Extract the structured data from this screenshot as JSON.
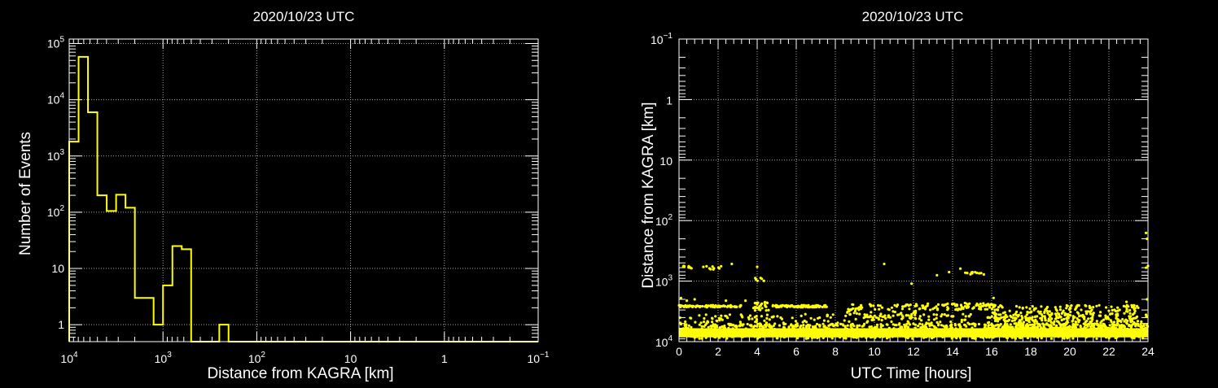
{
  "colors": {
    "background": "#000000",
    "axis": "#ffffff",
    "grid": "#aaaaaa",
    "series": "#ffff00"
  },
  "chart_data": [
    {
      "type": "histogram",
      "title": "2020/10/23 UTC",
      "xlabel": "Distance from KAGRA [km]",
      "ylabel": "Number of Events",
      "x_scale": "log",
      "x_reversed": true,
      "x_range": [
        10000,
        0.1
      ],
      "y_scale": "log",
      "y_range": [
        0.5,
        120000
      ],
      "grid": true,
      "x_tick_labels": [
        {
          "v": 10000,
          "base": "10",
          "exp": "4"
        },
        {
          "v": 1000,
          "base": "10",
          "exp": "3"
        },
        {
          "v": 100,
          "base": "10",
          "exp": "2"
        },
        {
          "v": 10,
          "base": "10",
          "exp": ""
        },
        {
          "v": 1,
          "base": "1",
          "exp": ""
        },
        {
          "v": 0.1,
          "base": "10",
          "exp": "−1"
        }
      ],
      "y_tick_labels": [
        {
          "v": 1,
          "base": "1",
          "exp": ""
        },
        {
          "v": 10,
          "base": "10",
          "exp": ""
        },
        {
          "v": 100,
          "base": "10",
          "exp": "2"
        },
        {
          "v": 1000,
          "base": "10",
          "exp": "3"
        },
        {
          "v": 10000,
          "base": "10",
          "exp": "4"
        },
        {
          "v": 100000,
          "base": "10",
          "exp": "5"
        }
      ],
      "bins": [
        {
          "from": 10000,
          "to": 7943,
          "value": 1800
        },
        {
          "from": 7943,
          "to": 6310,
          "value": 58000
        },
        {
          "from": 6310,
          "to": 5012,
          "value": 6000
        },
        {
          "from": 5012,
          "to": 3981,
          "value": 200
        },
        {
          "from": 3981,
          "to": 3162,
          "value": 105
        },
        {
          "from": 3162,
          "to": 2512,
          "value": 205
        },
        {
          "from": 2512,
          "to": 1995,
          "value": 120
        },
        {
          "from": 1995,
          "to": 1585,
          "value": 3
        },
        {
          "from": 1585,
          "to": 1259,
          "value": 3
        },
        {
          "from": 1259,
          "to": 1000,
          "value": 1
        },
        {
          "from": 1000,
          "to": 794,
          "value": 5
        },
        {
          "from": 794,
          "to": 631,
          "value": 25
        },
        {
          "from": 631,
          "to": 501,
          "value": 22
        },
        {
          "from": 501,
          "to": 398,
          "value": 0
        },
        {
          "from": 398,
          "to": 316,
          "value": 0
        },
        {
          "from": 316,
          "to": 251,
          "value": 0
        },
        {
          "from": 251,
          "to": 200,
          "value": 1
        },
        {
          "from": 200,
          "to": 158,
          "value": 0
        }
      ]
    },
    {
      "type": "scatter",
      "title": "2020/10/23 UTC",
      "xlabel": "UTC Time [hours]",
      "ylabel": "Distance from KAGRA [km]",
      "x_range": [
        0,
        24
      ],
      "y_scale": "log",
      "y_reversed": true,
      "y_range": [
        0.1,
        10000
      ],
      "grid": true,
      "x_ticks": [
        "0",
        "2",
        "4",
        "6",
        "8",
        "10",
        "12",
        "14",
        "16",
        "18",
        "20",
        "22",
        "24"
      ],
      "y_tick_labels": [
        {
          "v": 0.1,
          "base": "10",
          "exp": "−1"
        },
        {
          "v": 1,
          "base": "1",
          "exp": ""
        },
        {
          "v": 10,
          "base": "10",
          "exp": ""
        },
        {
          "v": 100,
          "base": "10",
          "exp": "2"
        },
        {
          "v": 1000,
          "base": "10",
          "exp": "3"
        },
        {
          "v": 10000,
          "base": "10",
          "exp": "4"
        }
      ],
      "dense_band": {
        "x_range": [
          0,
          24
        ],
        "y_range": [
          6000,
          8500
        ]
      },
      "clusters": [
        {
          "x": [
            0,
            3.2
          ],
          "y": [
            2500,
            2700
          ],
          "count": 90
        },
        {
          "x": [
            3.8,
            4.6
          ],
          "y": [
            2200,
            3200
          ],
          "count": 30
        },
        {
          "x": [
            4.8,
            7.6
          ],
          "y": [
            2500,
            2700
          ],
          "count": 80
        },
        {
          "x": [
            8.6,
            9.4
          ],
          "y": [
            2400,
            3600
          ],
          "count": 25
        },
        {
          "x": [
            9.6,
            12.2
          ],
          "y": [
            2400,
            4200
          ],
          "count": 60
        },
        {
          "x": [
            12.2,
            16.2
          ],
          "y": [
            2300,
            3000
          ],
          "count": 90
        },
        {
          "x": [
            16,
            23.5
          ],
          "y": [
            2500,
            4800
          ],
          "count": 260
        },
        {
          "x": [
            0,
            24
          ],
          "y": [
            3500,
            5800
          ],
          "count": 320
        },
        {
          "x": [
            16.5,
            24
          ],
          "y": [
            5000,
            7000
          ],
          "count": 200
        },
        {
          "x": [
            0.1,
            1.8
          ],
          "y": [
            550,
            650
          ],
          "count": 10
        },
        {
          "x": [
            1.3,
            2.2
          ],
          "y": [
            560,
            640
          ],
          "count": 8
        },
        {
          "x": [
            3.9,
            4.4
          ],
          "y": [
            850,
            1050
          ],
          "count": 6
        },
        {
          "x": [
            13.3,
            15.6
          ],
          "y": [
            700,
            780
          ],
          "count": 12
        }
      ],
      "outliers": [
        {
          "x": 0.1,
          "y": 1900
        },
        {
          "x": 0.4,
          "y": 2100
        },
        {
          "x": 0.8,
          "y": 2000
        },
        {
          "x": 2.4,
          "y": 2100
        },
        {
          "x": 2.7,
          "y": 520
        },
        {
          "x": 3.4,
          "y": 2100
        },
        {
          "x": 4.0,
          "y": 580
        },
        {
          "x": 10.5,
          "y": 520
        },
        {
          "x": 11.9,
          "y": 1100
        },
        {
          "x": 13.2,
          "y": 800
        },
        {
          "x": 14.4,
          "y": 620
        },
        {
          "x": 16.1,
          "y": 1900
        },
        {
          "x": 22.9,
          "y": 2200
        },
        {
          "x": 23.9,
          "y": 160
        },
        {
          "x": 23.95,
          "y": 200
        },
        {
          "x": 24.0,
          "y": 560
        },
        {
          "x": 23.9,
          "y": 600
        },
        {
          "x": 23.95,
          "y": 2000
        }
      ]
    }
  ]
}
